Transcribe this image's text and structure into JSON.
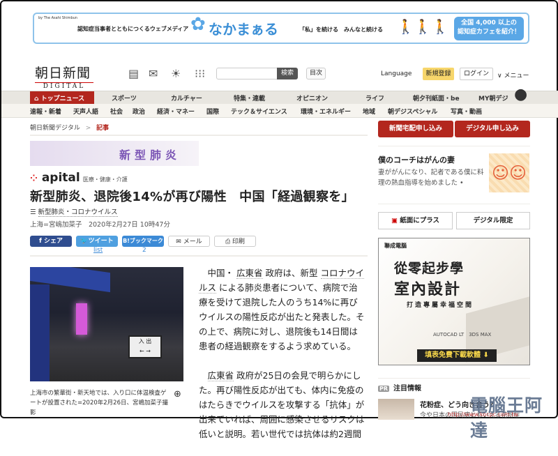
{
  "ad_banner": {
    "by": "by The Asahi Shimbun",
    "tagline": "認知症当事者とともにつくるウェブメディア",
    "logo": "なかまぁる",
    "tagline2": "「私」を続ける　みんなと続ける",
    "cta_line1": "全国 4,000 以上の",
    "cta_line2": "認知症カフェを紹介！"
  },
  "header": {
    "logo_jp": "朝日新聞",
    "logo_en": "DIGITAL",
    "search_placeholder": "",
    "search_button": "検索",
    "toc": "目次",
    "language": "Language",
    "register": "新規登録",
    "login": "ログイン",
    "menu": "∨ メニュー"
  },
  "nav_primary": [
    "トップニュース",
    "スポーツ",
    "カルチャー",
    "特集・連載",
    "オピニオン",
    "ライフ",
    "朝夕刊紙面・be",
    "MY朝デジ"
  ],
  "nav_secondary": [
    "速報・新着",
    "天声人語",
    "社会",
    "政治",
    "経済・マネー",
    "国際",
    "テック＆サイエンス",
    "環境・エネルギー",
    "地域",
    "朝デジスペシャル",
    "写真・動画"
  ],
  "breadcrumb": {
    "home": "朝日新聞デジタル",
    "sep": ">",
    "current": "記事"
  },
  "section_banner": "新型肺炎",
  "apital": {
    "logo": "apital",
    "sub": "医療・健康・介護"
  },
  "article": {
    "headline": "新型肺炎、退院後14%が再び陽性　中国「経過観察を」",
    "tag": "新型肺炎・コロナウイルス",
    "byline": "上海=宮嶋加菜子　2020年2月27日 10時47分",
    "share": {
      "facebook": "シェア",
      "twitter": "ツイート",
      "hatena": "ブックマーク",
      "mail": "メール",
      "print": "印刷",
      "twitter_count": "list",
      "hatena_count": "2"
    },
    "photo_caption": "上海市の繁華街・新天地では、入り口に体温検査ゲートが設置された=2020年2月26日、宮嶋加菜子撮影",
    "p1": [
      "中国・",
      "広東省",
      "政府は、新型",
      "コロナウイルス",
      "による肺炎患者について、病院で治療を受けて退院した人のうち14%に再びウイルスの陽性反応が出たと発表した。その上で、病院に対し、退院後も14日間は患者の経過観察をするよう求めている。"
    ],
    "p2": [
      "広東省",
      "政府が25日の会見で明らかにした。再び陽性反応が出ても、体内に免疫のはたらきでウイルスを攻撃する「抗体」が出来ていれば、周囲に感染させるリスクは低いと説明。若い世代では抗体は約2週間"
    ]
  },
  "sidebar": {
    "subscribe_paper": "新聞宅配申し込み",
    "subscribe_digital": "デジタル申し込み",
    "feature_title": "僕のコーチはがんの妻",
    "feature_desc": "妻ががんになり、記者である僕に料理の熱血指導を始めました •",
    "plus": "紙面にプラス",
    "digital_only": "デジタル限定",
    "ad": {
      "brand": "聯成電腦",
      "line1": "從零起步學",
      "line2": "室內設計",
      "line3": "打造專屬幸福空間",
      "software": "AUTOCAD LT　3DS MAX",
      "cta": "填表免費下載軟體 ⬇"
    },
    "pr_label": "PR",
    "pr_title": "注目情報",
    "pr_item_title": "花粉症、どう向き合う？",
    "pr_item_desc": "今や日本の国民病ともいえる花粉症"
  },
  "watermark": {
    "text": "電腦王阿達",
    "url": "http://www.kocpc.com.tw"
  },
  "colors": {
    "brand_red": "#b3271e",
    "register_yellow": "#f7d66b",
    "facebook": "#2f4d8f",
    "twitter": "#4fa0e0"
  }
}
